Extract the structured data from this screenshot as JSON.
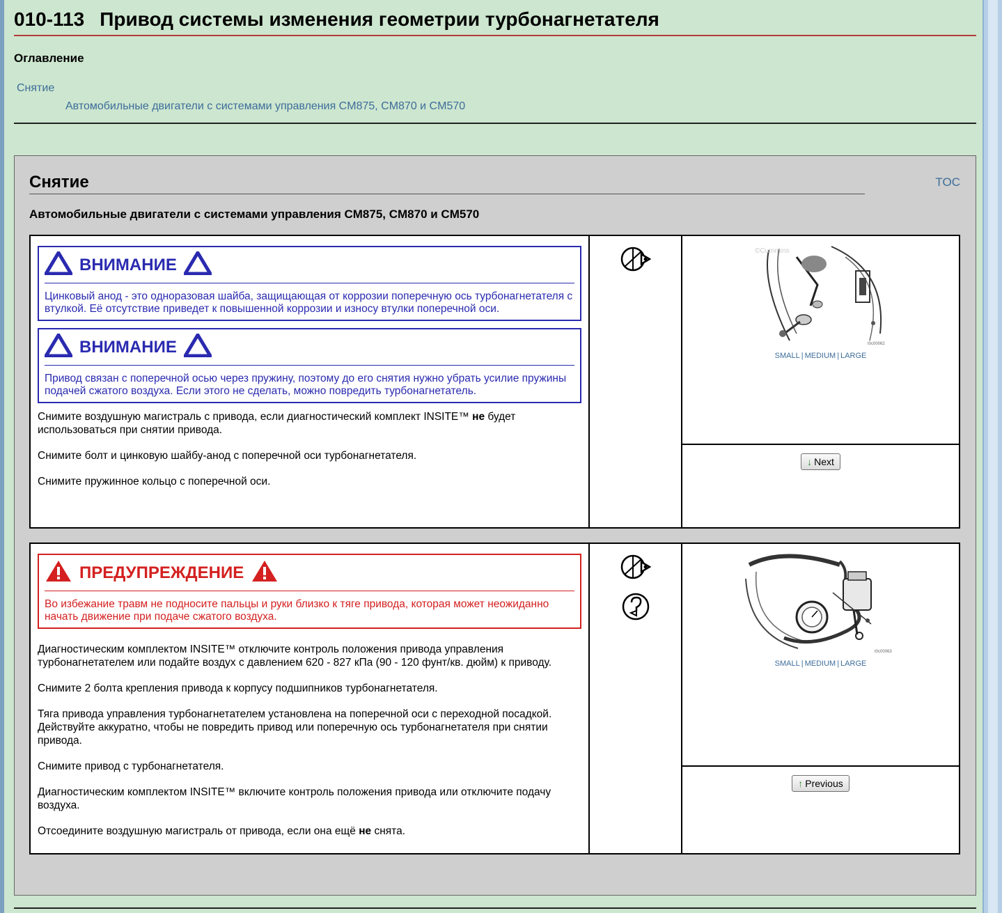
{
  "page": {
    "number": "010-113",
    "title": "Привод системы изменения геометрии турбонагнетателя"
  },
  "toc": {
    "heading": "Оглавление",
    "items": [
      {
        "label": "Снятие"
      },
      {
        "label": "Автомобильные двигатели с системами управления CM875, CM870 и CM570"
      }
    ]
  },
  "section": {
    "title": "Снятие",
    "toc_link": "TOC",
    "subtitle": "Автомобильные двигатели с системами управления CM875, CM870 и CM570"
  },
  "steps": [
    {
      "callouts": [
        {
          "type": "caution",
          "title": "ВНИМАНИЕ",
          "body": "Цинковый анод - это одноразовая шайба, защищающая от коррозии поперечную ось турбонагнетателя с втулкой. Её отсутствие приведет к повышенной коррозии и износу втулки поперечной оси."
        },
        {
          "type": "caution",
          "title": "ВНИМАНИЕ",
          "body": "Привод связан с поперечной осью через пружину, поэтому до его снятия нужно убрать усилие пружины подачей сжатого воздуха. Если этого не сделать, можно повредить турбонагнетатель."
        }
      ],
      "paragraphs": [
        {
          "pre": "Снимите воздушную магистраль с привода, если диагностический комплект INSITE™ ",
          "bold": "не",
          "post": " будет использоваться при снятии привода."
        },
        {
          "pre": "Снимите болт и цинковую шайбу-анод с поперечной оси турбонагнетателя.",
          "bold": "",
          "post": ""
        },
        {
          "pre": "Снимите пружинное кольцо с поперечной оси.",
          "bold": "",
          "post": ""
        }
      ],
      "icons": [
        "wrench-tool-icon"
      ],
      "image": {
        "watermark": "©Cummins",
        "code": "t0c00062",
        "sizes": [
          "SMALL",
          "MEDIUM",
          "LARGE"
        ]
      },
      "nav_button": {
        "label": "Next",
        "arrow": "↓"
      }
    },
    {
      "callouts": [
        {
          "type": "warning",
          "title": "ПРЕДУПРЕЖДЕНИЕ",
          "body": "Во избежание травм не подносите пальцы и руки близко к тяге привода, которая может неожиданно начать движение при подаче сжатого воздуха."
        }
      ],
      "paragraphs": [
        {
          "pre": "Диагностическим комплектом INSITE™ отключите контроль положения привода управления турбонагнетателем или подайте воздух с давлением 620 - 827 кПа (90 - 120 фунт/кв. дюйм) к приводу.",
          "bold": "",
          "post": ""
        },
        {
          "pre": "Снимите 2 болта крепления привода к корпусу подшипников турбонагнетателя.",
          "bold": "",
          "post": ""
        },
        {
          "pre": "Тяга привода управления турбонагнетателем установлена на поперечной оси с переходной посадкой. Действуйте аккуратно, чтобы не повредить привод или поперечную ось турбонагнетателя при снятии привода.",
          "bold": "",
          "post": ""
        },
        {
          "pre": "Снимите привод с турбонагнетателя.",
          "bold": "",
          "post": ""
        },
        {
          "pre": "Диагностическим комплектом INSITE™ включите контроль положения привода или отключите подачу воздуха.",
          "bold": "",
          "post": ""
        },
        {
          "pre": "Отсоедините воздушную магистраль от привода, если она ещё ",
          "bold": "не",
          "post": " снята."
        }
      ],
      "icons": [
        "wrench-tool-icon",
        "question-icon"
      ],
      "image": {
        "watermark": "",
        "code": "t0c00063",
        "sizes": [
          "SMALL",
          "MEDIUM",
          "LARGE"
        ]
      },
      "nav_button": {
        "label": "Previous",
        "arrow": "↑"
      }
    }
  ]
}
